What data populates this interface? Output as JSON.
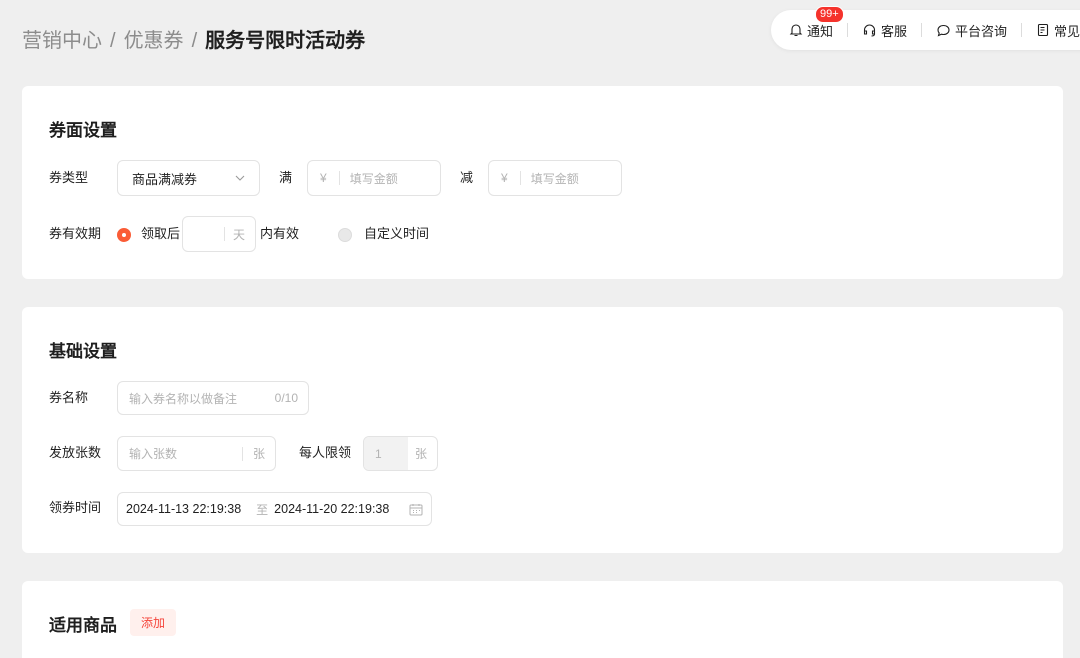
{
  "breadcrumb": {
    "items": [
      "营销中心",
      "优惠券"
    ],
    "separator": "/",
    "current": "服务号限时活动券"
  },
  "toolbar": {
    "notify_label": "通知",
    "notify_badge": "99+",
    "service_label": "客服",
    "consult_label": "平台咨询",
    "faq_label": "常见问"
  },
  "coupon_settings": {
    "title": "券面设置",
    "type_label": "券类型",
    "type_value": "商品满减券",
    "full_label": "满",
    "full_currency": "¥",
    "full_placeholder": "填写金额",
    "reduce_label": "减",
    "reduce_currency": "¥",
    "reduce_placeholder": "填写金额",
    "validity_label": "券有效期",
    "option_after_label": "领取后",
    "days_unit": "天",
    "within_label": "内有效",
    "option_custom_label": "自定义时间"
  },
  "basic_settings": {
    "title": "基础设置",
    "name_label": "券名称",
    "name_placeholder": "输入券名称以做备注",
    "name_counter": "0/10",
    "count_label": "发放张数",
    "count_placeholder": "输入张数",
    "count_unit": "张",
    "limit_label": "每人限领",
    "limit_value": "1",
    "limit_unit": "张",
    "time_label": "领券时间",
    "time_start": "2024-11-13 22:19:38",
    "time_to": "至",
    "time_end": "2024-11-20 22:19:38"
  },
  "products": {
    "title": "适用商品",
    "add_label": "添加"
  },
  "colors": {
    "accent": "#fa5c36",
    "badge": "#f5332c",
    "background": "#efefef"
  }
}
